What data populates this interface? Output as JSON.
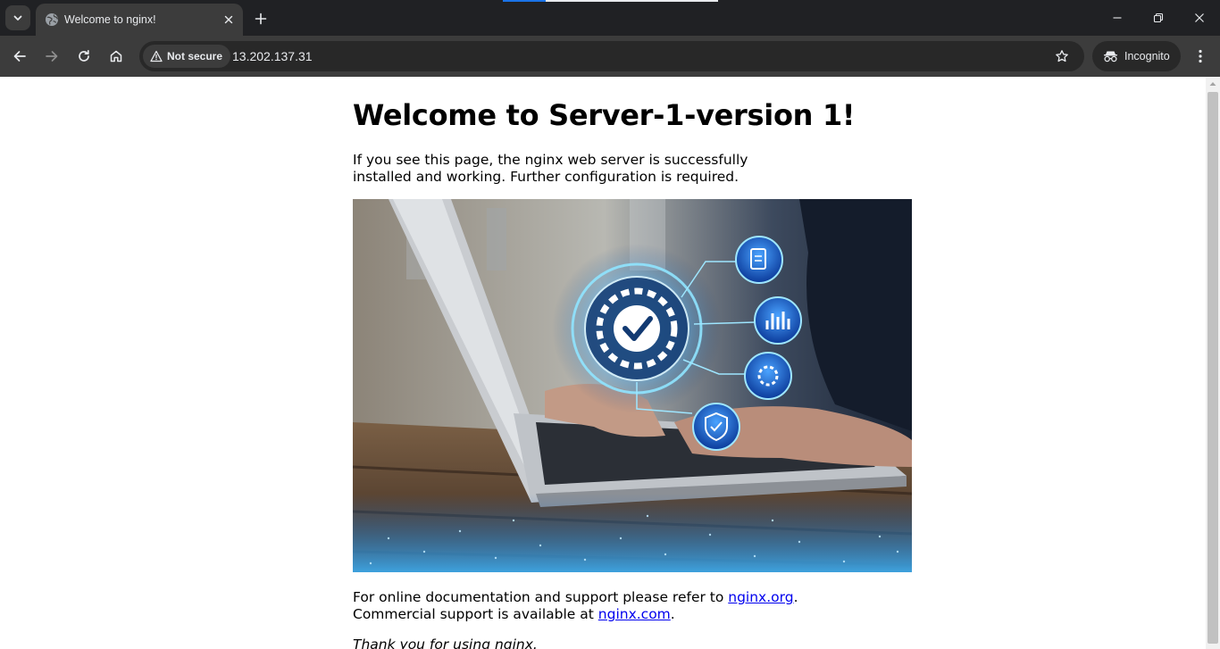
{
  "browser": {
    "tab": {
      "title": "Welcome to nginx!",
      "favicon": "globe-icon"
    },
    "omnibox": {
      "security_label": "Not secure",
      "url": "13.202.137.31"
    },
    "profile_label": "Incognito",
    "colors": {
      "frame": "#202124",
      "toolbar": "#3c3c3c",
      "omnibox": "#282828",
      "text": "#e8eaed"
    },
    "icons": [
      "tab-search-icon",
      "close-icon",
      "plus-icon",
      "minimize-icon",
      "restore-icon",
      "window-close-icon",
      "back-arrow-icon",
      "forward-arrow-icon",
      "reload-icon",
      "home-icon",
      "warning-triangle-icon",
      "star-icon",
      "incognito-icon",
      "kebab-menu-icon"
    ]
  },
  "page": {
    "heading": "Welcome to Server-1-version 1!",
    "intro": "If you see this page, the nginx web server is successfully installed and working. Further configuration is required.",
    "docs_prefix": "For online documentation and support please refer to ",
    "docs_link": "nginx.org",
    "docs_suffix": ".",
    "commercial_prefix": "Commercial support is available at ",
    "commercial_link": "nginx.com",
    "commercial_suffix": ".",
    "thanks": "Thank you for using nginx.",
    "link_color": "#0000ee"
  }
}
